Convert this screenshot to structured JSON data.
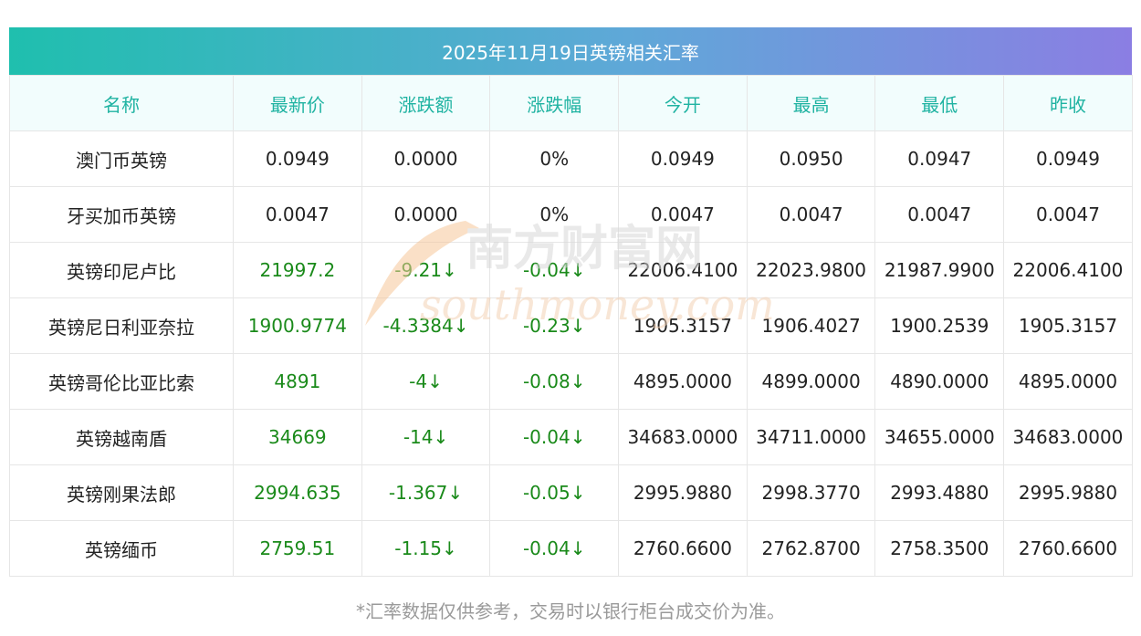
{
  "title": "2025年11月19日英镑相关汇率",
  "headers": [
    "名称",
    "最新价",
    "涨跌额",
    "涨跌幅",
    "今开",
    "最高",
    "最低",
    "昨收"
  ],
  "rows": [
    {
      "name": "澳门币英镑",
      "latest": "0.0949",
      "change": "0.0000",
      "pct": "0%",
      "open": "0.0949",
      "high": "0.0950",
      "low": "0.0947",
      "prev": "0.0949",
      "trend": "flat"
    },
    {
      "name": "牙买加币英镑",
      "latest": "0.0047",
      "change": "0.0000",
      "pct": "0%",
      "open": "0.0047",
      "high": "0.0047",
      "low": "0.0047",
      "prev": "0.0047",
      "trend": "flat"
    },
    {
      "name": "英镑印尼卢比",
      "latest": "21997.2",
      "change": "-9.21↓",
      "pct": "-0.04↓",
      "open": "22006.4100",
      "high": "22023.9800",
      "low": "21987.9900",
      "prev": "22006.4100",
      "trend": "down"
    },
    {
      "name": "英镑尼日利亚奈拉",
      "latest": "1900.9774",
      "change": "-4.3384↓",
      "pct": "-0.23↓",
      "open": "1905.3157",
      "high": "1906.4027",
      "low": "1900.2539",
      "prev": "1905.3157",
      "trend": "down"
    },
    {
      "name": "英镑哥伦比亚比索",
      "latest": "4891",
      "change": "-4↓",
      "pct": "-0.08↓",
      "open": "4895.0000",
      "high": "4899.0000",
      "low": "4890.0000",
      "prev": "4895.0000",
      "trend": "down"
    },
    {
      "name": "英镑越南盾",
      "latest": "34669",
      "change": "-14↓",
      "pct": "-0.04↓",
      "open": "34683.0000",
      "high": "34711.0000",
      "low": "34655.0000",
      "prev": "34683.0000",
      "trend": "down"
    },
    {
      "name": "英镑刚果法郎",
      "latest": "2994.635",
      "change": "-1.367↓",
      "pct": "-0.05↓",
      "open": "2995.9880",
      "high": "2998.3770",
      "low": "2993.4880",
      "prev": "2995.9880",
      "trend": "down"
    },
    {
      "name": "英镑缅币",
      "latest": "2759.51",
      "change": "-1.15↓",
      "pct": "-0.04↓",
      "open": "2760.6600",
      "high": "2762.8700",
      "low": "2758.3500",
      "prev": "2760.6600",
      "trend": "down"
    }
  ],
  "watermark": {
    "cn": "南方财富网",
    "en": "southmoney.com"
  },
  "footnote": "*汇率数据仅供参考，交易时以银行柜台成交价为准。",
  "colors": {
    "header_text": "#20b3a2",
    "down": "#1a8a1a",
    "header_bg": "#f2fdfd"
  }
}
